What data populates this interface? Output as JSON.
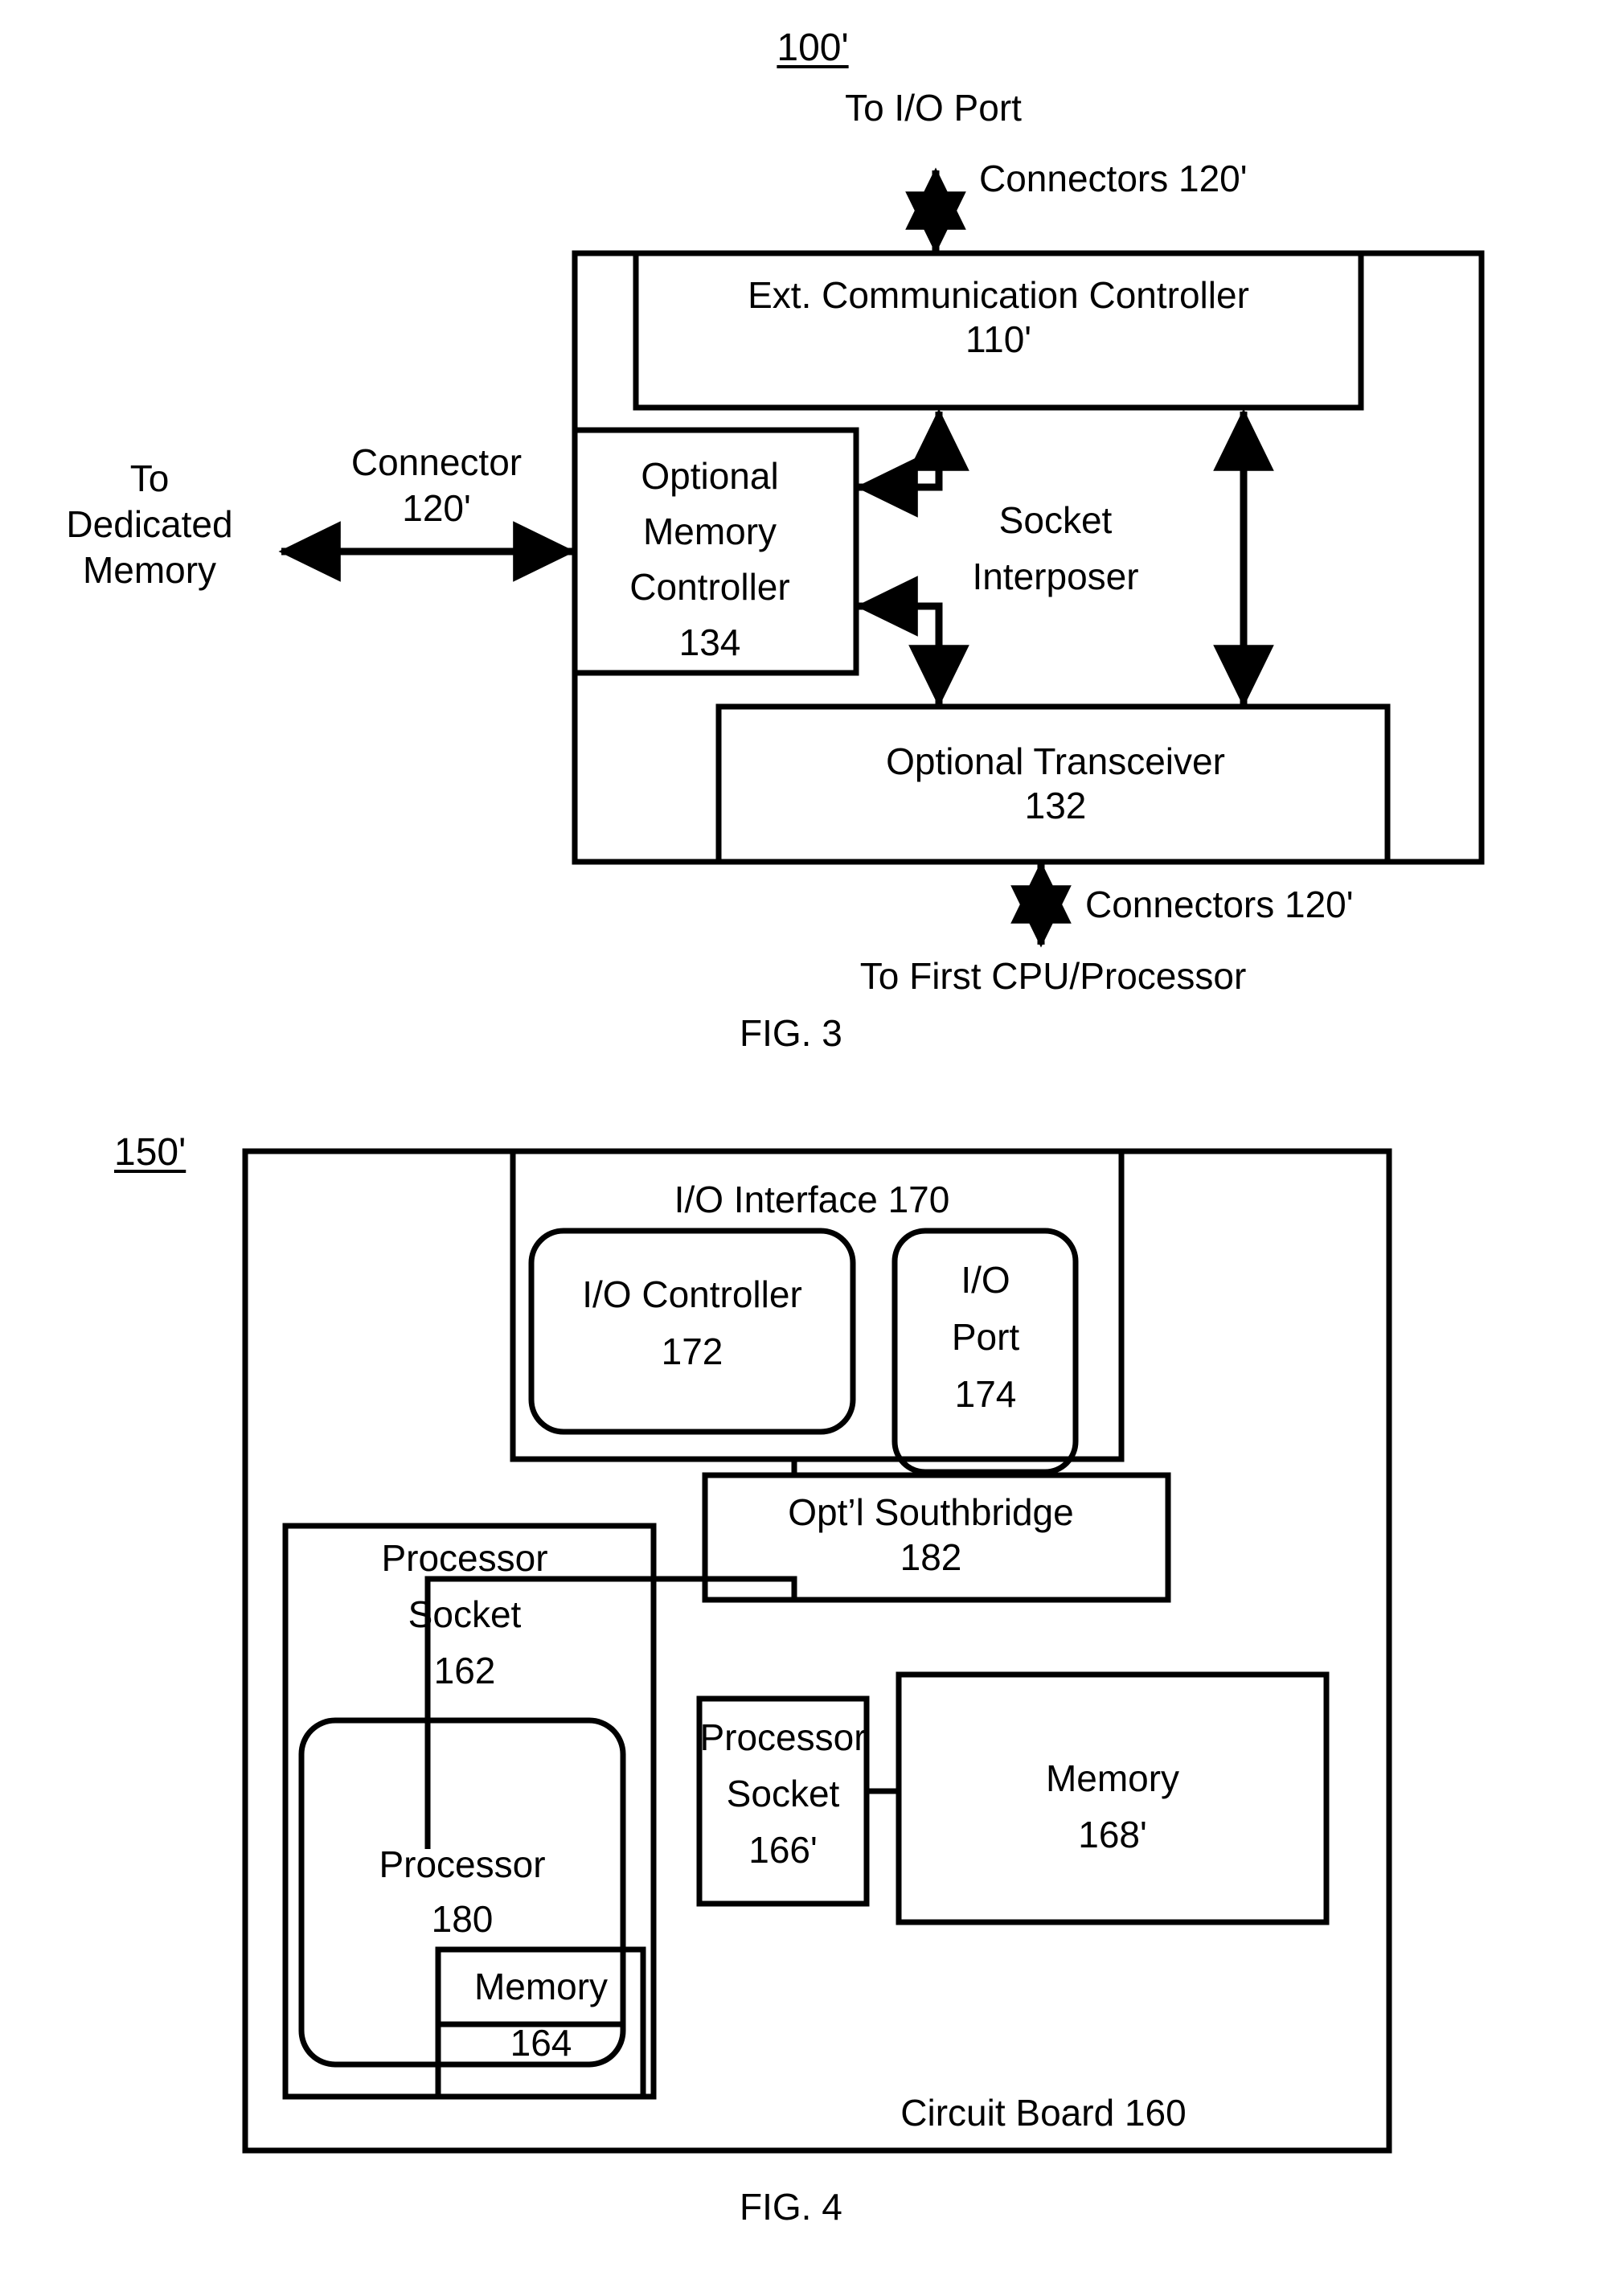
{
  "document": {
    "type": "patent-figure-sheet",
    "figures": [
      "FIG. 3",
      "FIG. 4"
    ]
  },
  "fig3": {
    "caption": "FIG. 3",
    "reference_numeral": "100'",
    "top_label": "To I/O Port",
    "top_connector_label": "Connectors 120'",
    "bottom_connector_label": "Connectors 120'",
    "bottom_label": "To First CPU/Processor",
    "left_label_line1": "To",
    "left_label_line2": "Dedicated",
    "left_label_line3": "Memory",
    "left_connector_line1": "Connector",
    "left_connector_line2": "120'",
    "interposer_line1": "Socket",
    "interposer_line2": "Interposer",
    "blocks": [
      {
        "name": "ext-communication-controller",
        "line1": "Ext. Communication Controller",
        "line2": "110'"
      },
      {
        "name": "optional-memory-controller",
        "line1": "Optional",
        "line2": "Memory",
        "line3": "Controller",
        "line4": "134"
      },
      {
        "name": "optional-transceiver",
        "line1": "Optional Transceiver",
        "line2": "132"
      }
    ]
  },
  "fig4": {
    "caption": "FIG. 4",
    "reference_numeral": "150'",
    "circuit_board_label": "Circuit Board 160",
    "blocks": [
      {
        "name": "io-interface",
        "line1": "I/O Interface 170"
      },
      {
        "name": "io-controller",
        "line1": "I/O Controller",
        "line2": "172"
      },
      {
        "name": "io-port",
        "line1": "I/O",
        "line2": "Port",
        "line3": "174"
      },
      {
        "name": "optional-southbridge",
        "line1": "Opt’l Southbridge",
        "line2": "182"
      },
      {
        "name": "processor-socket-162",
        "line1": "Processor",
        "line2": "Socket",
        "line3": "162"
      },
      {
        "name": "processor-180",
        "line1": "Processor",
        "line2": "180"
      },
      {
        "name": "processor-socket-166",
        "line1": "Processor",
        "line2": "Socket",
        "line3": "166'"
      },
      {
        "name": "memory-168",
        "line1": "Memory",
        "line2": "168'"
      },
      {
        "name": "memory-164",
        "line1": "Memory",
        "line2": "164"
      }
    ]
  }
}
